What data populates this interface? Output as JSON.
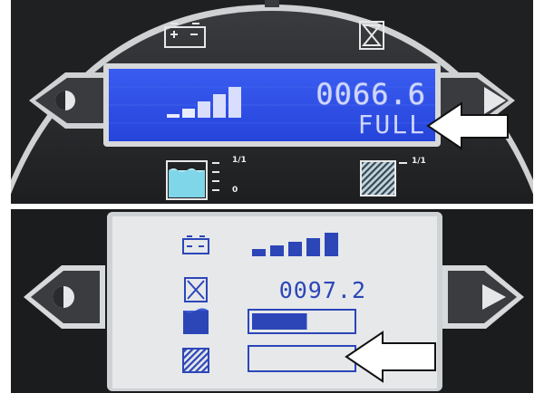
{
  "top_panel": {
    "odometer": "0066.6",
    "status": "FULL",
    "clean_scale_full": "1/1",
    "clean_scale_empty": "0",
    "recovery_scale_full": "1/1",
    "battery_level": 0.4
  },
  "bottom_panel": {
    "odometer": "0097.2",
    "battery_level": 1.0,
    "solution_level": 0.55,
    "recovery_level": 0.0
  },
  "colors": {
    "lcd_blue": "#2a4fe6",
    "lcd_grey": "#e4e6e8",
    "bezel": "#2e2f31"
  }
}
